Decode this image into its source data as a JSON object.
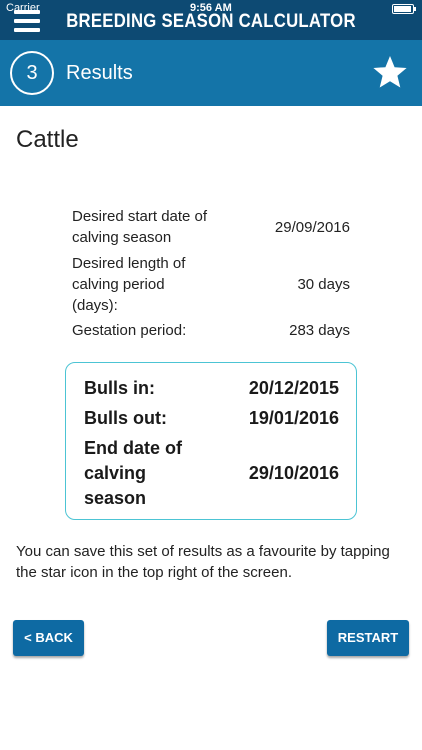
{
  "status": {
    "carrier": "Carrier",
    "time": "9:56 AM"
  },
  "header": {
    "title": "BREEDING SEASON CALCULATOR"
  },
  "step": {
    "number": "3",
    "title": "Results"
  },
  "species": "Cattle",
  "inputs": [
    {
      "label": "Desired start date of calving season",
      "value": "29/09/2016"
    },
    {
      "label": "Desired length of calving period (days):",
      "value": "30 days"
    },
    {
      "label": "Gestation period:",
      "value": "283 days"
    }
  ],
  "results": [
    {
      "label": "Bulls in:",
      "value": "20/12/2015"
    },
    {
      "label": "Bulls out:",
      "value": "19/01/2016"
    },
    {
      "label": "End date of calving season",
      "value": "29/10/2016"
    }
  ],
  "note": "You can save this set of results as a favourite by tapping the star icon in the top right of the screen.",
  "buttons": {
    "back": "< BACK",
    "restart": "RESTART"
  },
  "colors": {
    "titlebar": "#0d4a73",
    "stepbar": "#1474a8",
    "button": "#0e6aa3",
    "result_border": "#4cc4d4"
  }
}
